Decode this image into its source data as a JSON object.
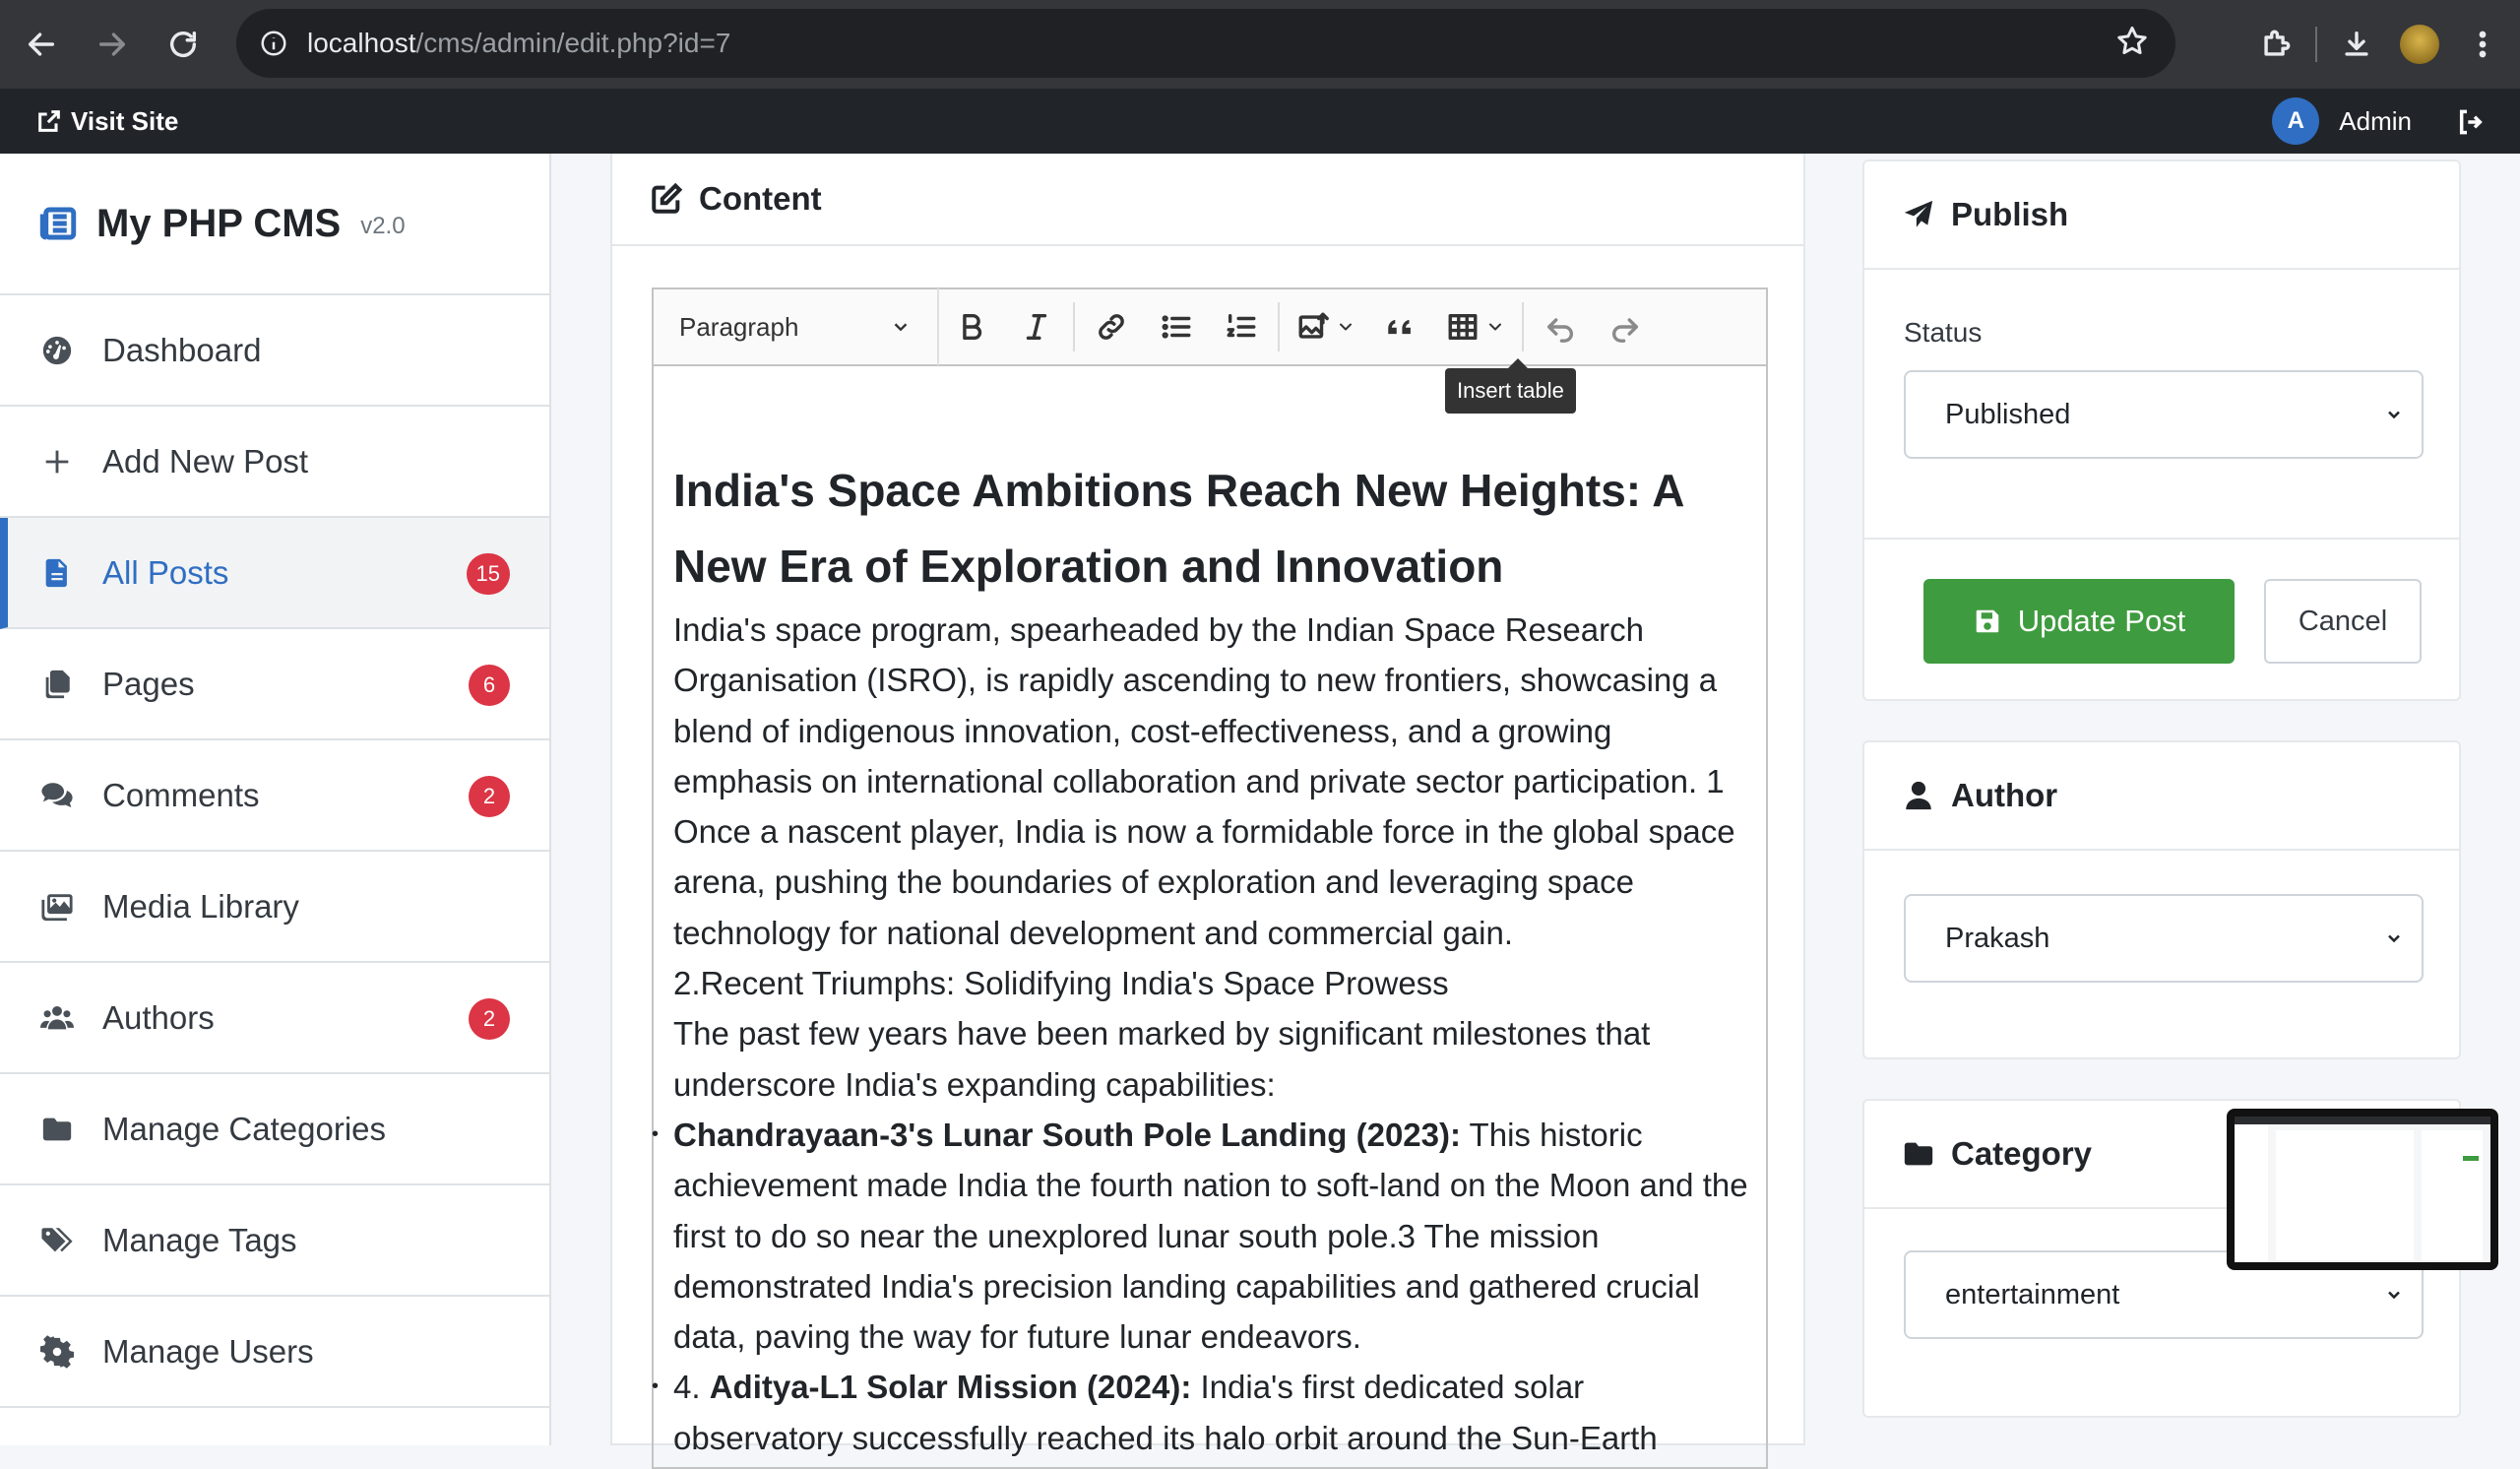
{
  "browser": {
    "url_host": "localhost",
    "url_path": "/cms/admin/edit.php?id=7"
  },
  "admin_bar": {
    "visit_site": "Visit Site",
    "avatar_letter": "A",
    "user_name": "Admin"
  },
  "sidebar": {
    "brand_title": "My PHP CMS",
    "brand_version": "v2.0",
    "items": [
      {
        "label": "Dashboard",
        "icon": "gauge-icon",
        "badge": null
      },
      {
        "label": "Add New Post",
        "icon": "plus-icon",
        "badge": null
      },
      {
        "label": "All Posts",
        "icon": "file-icon",
        "badge": "15",
        "active": true
      },
      {
        "label": "Pages",
        "icon": "copy-icon",
        "badge": "6"
      },
      {
        "label": "Comments",
        "icon": "comments-icon",
        "badge": "2"
      },
      {
        "label": "Media Library",
        "icon": "images-icon",
        "badge": null
      },
      {
        "label": "Authors",
        "icon": "users-icon",
        "badge": "2"
      },
      {
        "label": "Manage Categories",
        "icon": "folder-icon",
        "badge": null
      },
      {
        "label": "Manage Tags",
        "icon": "tags-icon",
        "badge": null
      },
      {
        "label": "Manage Users",
        "icon": "gear-icon",
        "badge": null
      }
    ]
  },
  "content": {
    "header": "Content",
    "toolbar": {
      "paragraph": "Paragraph",
      "tooltip": "Insert table"
    },
    "heading": "India's Space Ambitions Reach New Heights: A New Era of Exploration and Innovation",
    "p1": "India's space program, spearheaded by the Indian Space Research Organisation (ISRO), is rapidly ascending to new frontiers, showcasing a blend of indigenous innovation, cost-effectiveness, and a growing emphasis on international collaboration and private sector participation. 1 Once a nascent player, India is now a formidable force in the global space arena, pushing the boundaries of exploration and leveraging space technology for national development and commercial gain.",
    "p2": "2.Recent Triumphs: Solidifying India's Space Prowess",
    "p3": "The past few years have been marked by significant milestones that underscore India's expanding capabilities:",
    "li1_bold": "Chandrayaan-3's Lunar South Pole Landing (2023):",
    "li1_text": " This historic achievement made India the fourth nation to soft-land on the Moon and the first to do so near the unexplored lunar south pole.3 The mission demonstrated India's precision landing capabilities and gathered crucial data, paving the way for future lunar endeavors.",
    "li2_prefix": "4. ",
    "li2_bold": "Aditya-L1 Solar Mission (2024):",
    "li2_text": " India's first dedicated solar observatory successfully reached its halo orbit around the Sun-Earth"
  },
  "publish": {
    "title": "Publish",
    "status_label": "Status",
    "status_value": "Published",
    "update_label": "Update Post",
    "cancel_label": "Cancel"
  },
  "author": {
    "title": "Author",
    "value": "Prakash"
  },
  "category": {
    "title": "Category",
    "value": "entertainment"
  }
}
